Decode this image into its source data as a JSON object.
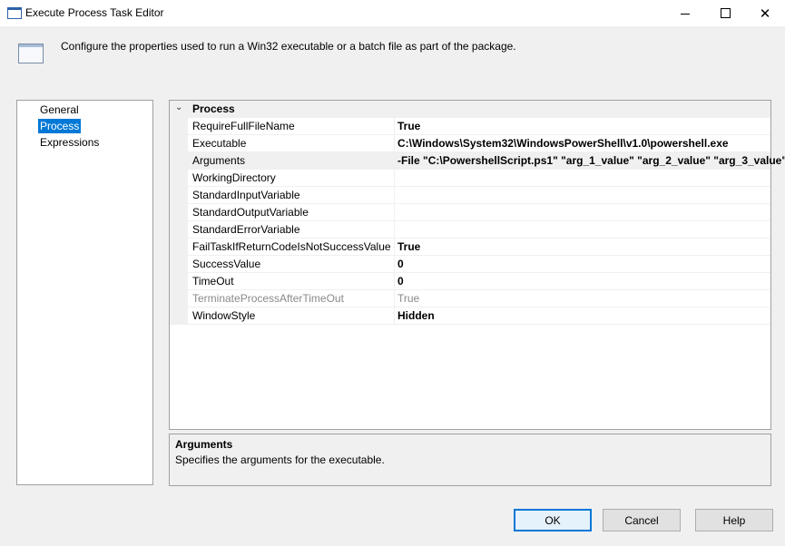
{
  "window": {
    "title": "Execute Process Task Editor",
    "minimize_icon": "minimize-icon",
    "maximize_icon": "maximize-icon",
    "close_glyph": "✕"
  },
  "header": {
    "description": "Configure the properties used to run a Win32 executable or a batch file as part of the package."
  },
  "nav": {
    "items": [
      {
        "label": "General",
        "selected": false
      },
      {
        "label": "Process",
        "selected": true
      },
      {
        "label": "Expressions",
        "selected": false
      }
    ]
  },
  "grid": {
    "category": "Process",
    "collapse_glyph": "⌄",
    "properties": [
      {
        "name": "RequireFullFileName",
        "value": "True"
      },
      {
        "name": "Executable",
        "value": "C:\\Windows\\System32\\WindowsPowerShell\\v1.0\\powershell.exe"
      },
      {
        "name": "Arguments",
        "value": "-File \"C:\\PowershellScript.ps1\" \"arg_1_value\" \"arg_2_value\" \"arg_3_value\""
      },
      {
        "name": "WorkingDirectory",
        "value": ""
      },
      {
        "name": "StandardInputVariable",
        "value": ""
      },
      {
        "name": "StandardOutputVariable",
        "value": ""
      },
      {
        "name": "StandardErrorVariable",
        "value": ""
      },
      {
        "name": "FailTaskIfReturnCodeIsNotSuccessValue",
        "value": "True"
      },
      {
        "name": "SuccessValue",
        "value": "0"
      },
      {
        "name": "TimeOut",
        "value": "0"
      },
      {
        "name": "TerminateProcessAfterTimeOut",
        "value": "True"
      },
      {
        "name": "WindowStyle",
        "value": "Hidden"
      }
    ]
  },
  "help": {
    "title": "Arguments",
    "text": "Specifies the arguments for the executable."
  },
  "buttons": {
    "ok": "OK",
    "cancel": "Cancel",
    "help": "Help"
  }
}
